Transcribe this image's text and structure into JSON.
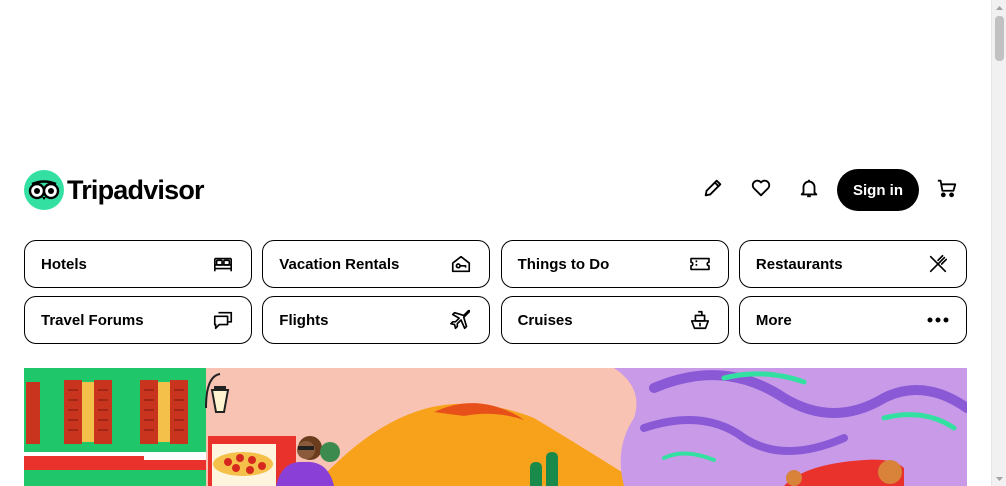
{
  "brand": {
    "name": "Tripadvisor",
    "logo_icon": "owl-eyes-icon",
    "accent": "#34e0a1"
  },
  "header": {
    "actions": [
      {
        "icon": "pencil-icon",
        "name": "review-button"
      },
      {
        "icon": "heart-icon",
        "name": "trips-button"
      },
      {
        "icon": "bell-icon",
        "name": "notifications-button"
      }
    ],
    "signin_label": "Sign in",
    "cart_icon": "cart-icon"
  },
  "categories": [
    {
      "label": "Hotels",
      "icon": "bed-icon"
    },
    {
      "label": "Vacation Rentals",
      "icon": "house-key-icon"
    },
    {
      "label": "Things to Do",
      "icon": "ticket-icon"
    },
    {
      "label": "Restaurants",
      "icon": "fork-knife-icon"
    },
    {
      "label": "Travel Forums",
      "icon": "chat-bubbles-icon"
    },
    {
      "label": "Flights",
      "icon": "airplane-icon"
    },
    {
      "label": "Cruises",
      "icon": "ship-icon"
    },
    {
      "label": "More",
      "icon": "more-dots-icon"
    }
  ],
  "colors": {
    "text": "#000000",
    "signin_bg": "#000000",
    "hero_pink": "#f9c3b4",
    "hero_green": "#1fc66a",
    "hero_purple": "#c99ae8",
    "hero_orange": "#f7a21a"
  }
}
